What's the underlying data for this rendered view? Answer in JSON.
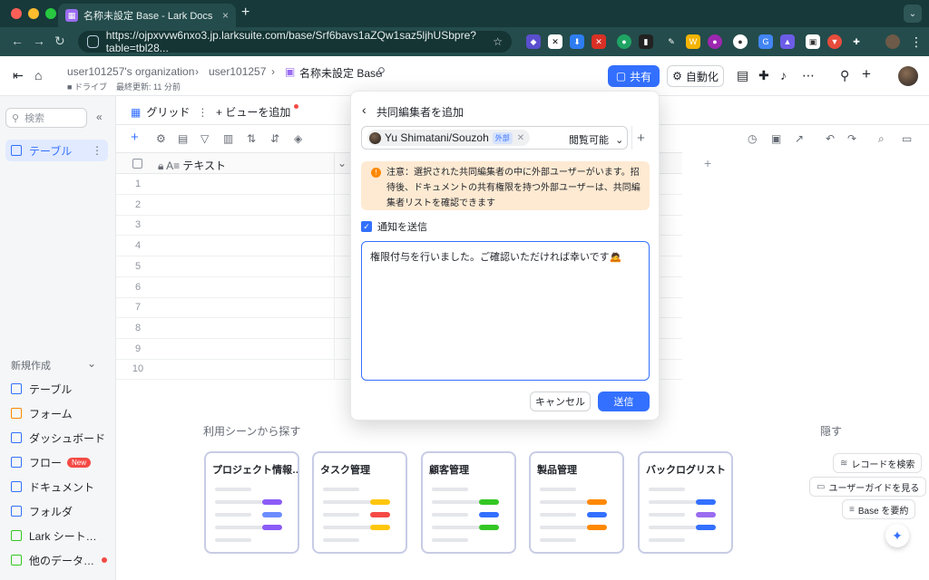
{
  "browser": {
    "tab_title": "名称未設定 Base - Lark Docs",
    "tab_close": "×",
    "new_tab": "+",
    "url": "https://ojpxvvw6nxo3.jp.larksuite.com/base/Srf6bavs1aZQw1saz5ljhUSbpre?table=tbl28..."
  },
  "header": {
    "org": "user101257's organization",
    "user": "user101257",
    "doc_title": "名称未設定 Base",
    "meta_drive": "ドライブ",
    "meta_updated": "最終更新: 11 分前",
    "share_label": "共有",
    "automation_label": "自動化"
  },
  "sidebar": {
    "search_placeholder": "検索",
    "table_item": "テーブル",
    "new_create": "新規作成",
    "items": [
      {
        "label": "テーブル",
        "icon": "table-icon",
        "color": "#3370ff"
      },
      {
        "label": "フォーム",
        "icon": "form-icon",
        "color": "#ff8800"
      },
      {
        "label": "ダッシュボード",
        "icon": "dashboard-icon",
        "color": "#3370ff"
      },
      {
        "label": "フロー",
        "icon": "flow-icon",
        "color": "#3370ff",
        "badge": "New"
      },
      {
        "label": "ドキュメント",
        "icon": "document-icon",
        "color": "#3370ff"
      },
      {
        "label": "フォルダ",
        "icon": "folder-icon",
        "color": "#3370ff"
      },
      {
        "label": "Lark シート…",
        "icon": "sheet-icon",
        "color": "#34c724"
      },
      {
        "label": "他のデータ…",
        "icon": "database-icon",
        "color": "#34c724"
      }
    ]
  },
  "views": {
    "grid_tab": "グリッド",
    "add_view": "ビューを追加"
  },
  "grid": {
    "column_header": "テキスト",
    "rows": [
      "1",
      "2",
      "3",
      "4",
      "5",
      "6",
      "7",
      "8",
      "9",
      "10"
    ]
  },
  "templates": {
    "title": "利用シーンから探す",
    "hide": "隠す",
    "cards": [
      {
        "title": "プロジェクト情報…"
      },
      {
        "title": "タスク管理"
      },
      {
        "title": "顧客管理"
      },
      {
        "title": "製品管理"
      },
      {
        "title": "バックログリスト"
      }
    ]
  },
  "floating": {
    "search_records": "レコードを検索",
    "user_guide": "ユーザーガイドを見る",
    "summarize": "Base を要約"
  },
  "modal": {
    "title": "共同編集者を追加",
    "user_name": "Yu Shimatani/Souzoh",
    "external_badge": "外部",
    "permission": "閲覧可能",
    "warning": "注意：選択された共同編集者の中に外部ユーザーがいます。招待後、ドキュメントの共有権限を持つ外部ユーザーは、共同編集者リストを確認できます",
    "notify_label": "通知を送信",
    "message": "権限付与を行いました。ご確認いただければ幸いです🙇",
    "cancel_label": "キャンセル",
    "send_label": "送信"
  }
}
